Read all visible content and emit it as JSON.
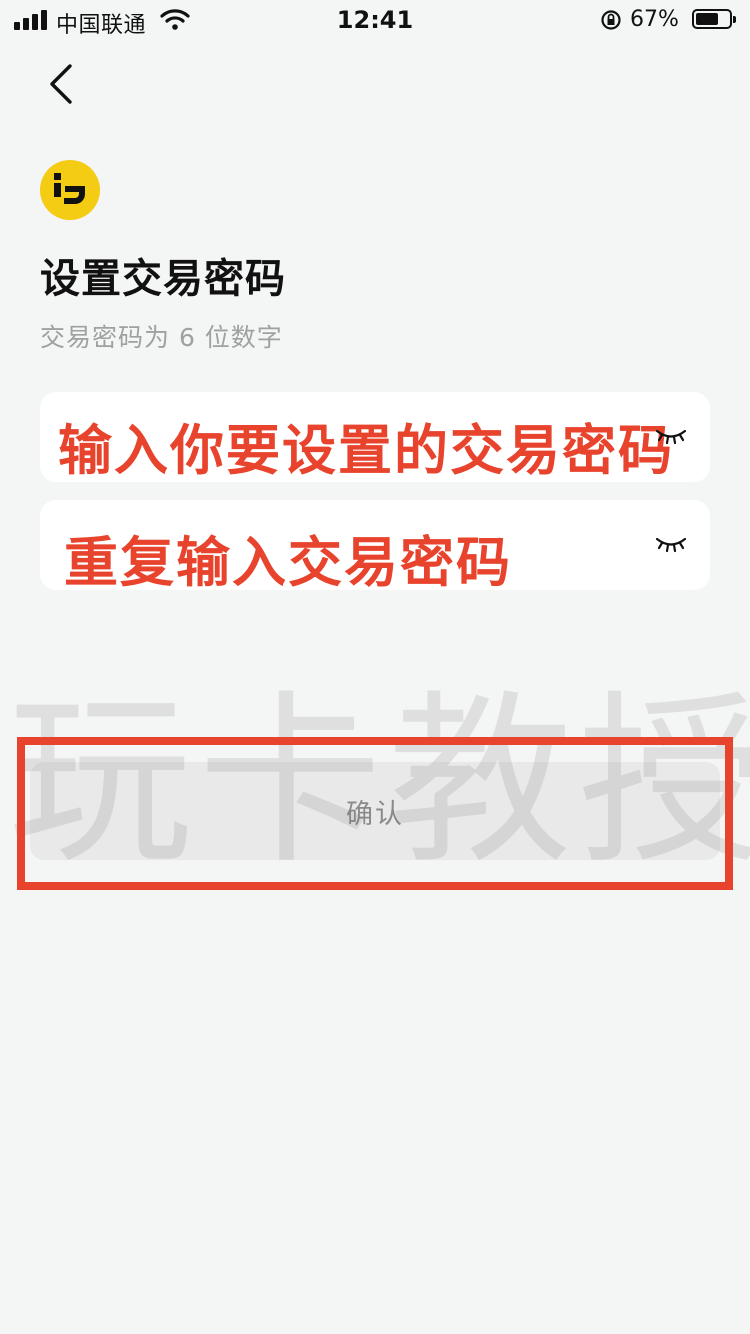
{
  "status_bar": {
    "carrier": "中国联通",
    "time": "12:41",
    "battery_percent": "67%",
    "battery_level": 0.67
  },
  "header": {
    "back_icon": "chevron-left-icon"
  },
  "logo": {
    "icon": "app-logo-icon",
    "color": "#f5cc14"
  },
  "page": {
    "title": "设置交易密码",
    "subtitle": "交易密码为 6 位数字"
  },
  "fields": [
    {
      "overlay_label": "输入你要设置的交易密码",
      "eye_icon": "eye-closed-icon"
    },
    {
      "overlay_label": "重复输入交易密码",
      "eye_icon": "eye-closed-icon"
    }
  ],
  "confirm": {
    "label": "确认"
  },
  "watermark": "玩卡教授",
  "colors": {
    "accent_red": "#e8432c",
    "logo_yellow": "#f5cc14",
    "background": "#f4f5f5"
  }
}
